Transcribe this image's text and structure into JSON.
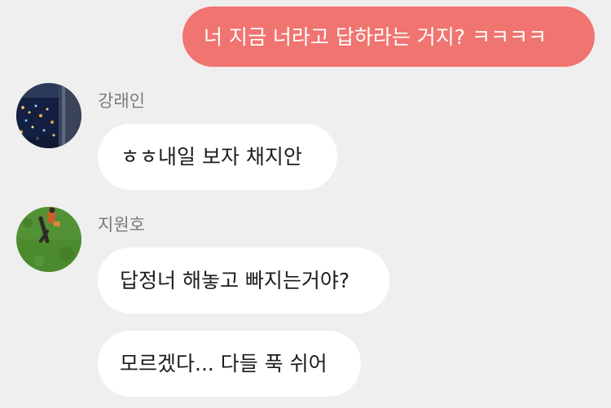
{
  "conversation": {
    "outgoing": [
      {
        "text": "너 지금 너라고 답하라는 거지? ㅋㅋㅋㅋ"
      }
    ],
    "groups": [
      {
        "sender": "강래인",
        "avatar_icon": "night-city-photo-avatar",
        "messages": [
          {
            "text": "ㅎㅎ내일 보자 채지안"
          }
        ]
      },
      {
        "sender": "지원호",
        "avatar_icon": "grass-field-person-photo-avatar",
        "messages": [
          {
            "text": "답정너 해놓고 빠지는거야?"
          },
          {
            "text": "모르겠다... 다들 푹 쉬어"
          }
        ]
      }
    ]
  },
  "colors": {
    "background": "#efefef",
    "outgoing_bubble": "#f07470",
    "incoming_bubble": "#ffffff",
    "sender_name": "#7a7a7a"
  }
}
